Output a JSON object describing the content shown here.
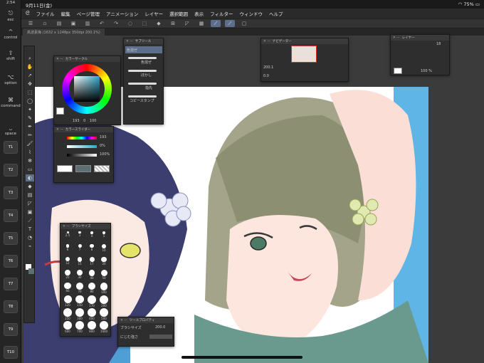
{
  "status": {
    "time": "2:54",
    "date": "9月11日(金)",
    "battery": "75%"
  },
  "menu": [
    "ファイル",
    "編集",
    "ページ管理",
    "アニメーション",
    "レイヤー",
    "選択範囲",
    "表示",
    "フィルター",
    "ウィンドウ",
    "ヘルプ"
  ],
  "modifiers": {
    "esc": "esc",
    "control": "control",
    "shift": "shift",
    "option": "option",
    "command": "command",
    "space": "space",
    "tkeys": [
      "T1",
      "T2",
      "T3",
      "T4",
      "T5",
      "T6",
      "T7",
      "T8",
      "T9",
      "T10"
    ]
  },
  "doc_tab": "高波素梅 (1632 x 1248px 350dpi 200.1%)",
  "color_circle": {
    "title": "カラーサークル",
    "h": "193",
    "s": "0",
    "v": "100",
    "color": "#5c6f73"
  },
  "color_slider": {
    "title": "カラースライダー",
    "h": "193",
    "s": "0%",
    "v": "100%",
    "color": "#5c6f73"
  },
  "subtool": {
    "title": "サブツール",
    "items": [
      "色混ぜ",
      "色混ぜ",
      "ぼかし",
      "指先",
      "コピースタンプ"
    ]
  },
  "navigator": {
    "title": "ナビゲーター",
    "zoom": "200.1",
    "angle": "0.0"
  },
  "layer": {
    "title": "レイヤー",
    "opacity": "100 %",
    "blend": "18"
  },
  "brushsize": {
    "title": "ブラシサイズ",
    "sizes": [
      "2.5",
      "3",
      "4",
      "5",
      "6",
      "7",
      "8",
      "10",
      "12",
      "15",
      "17",
      "20",
      "25",
      "30",
      "40",
      "50",
      "60",
      "70",
      "80",
      "100",
      "120",
      "150",
      "170",
      "200",
      "250",
      "300",
      "400",
      "500",
      "600",
      "700",
      "800",
      "1000"
    ]
  },
  "toolprop": {
    "title": "ツールプロパティ",
    "brush_label": "ブラシサイズ",
    "brush_value": "200.0",
    "blend_label": "にじむ強さ"
  },
  "colors": {
    "accent": "#5b6f8a",
    "canvas_bg": "#3b3b3b",
    "panel": "#2e2e2e"
  }
}
